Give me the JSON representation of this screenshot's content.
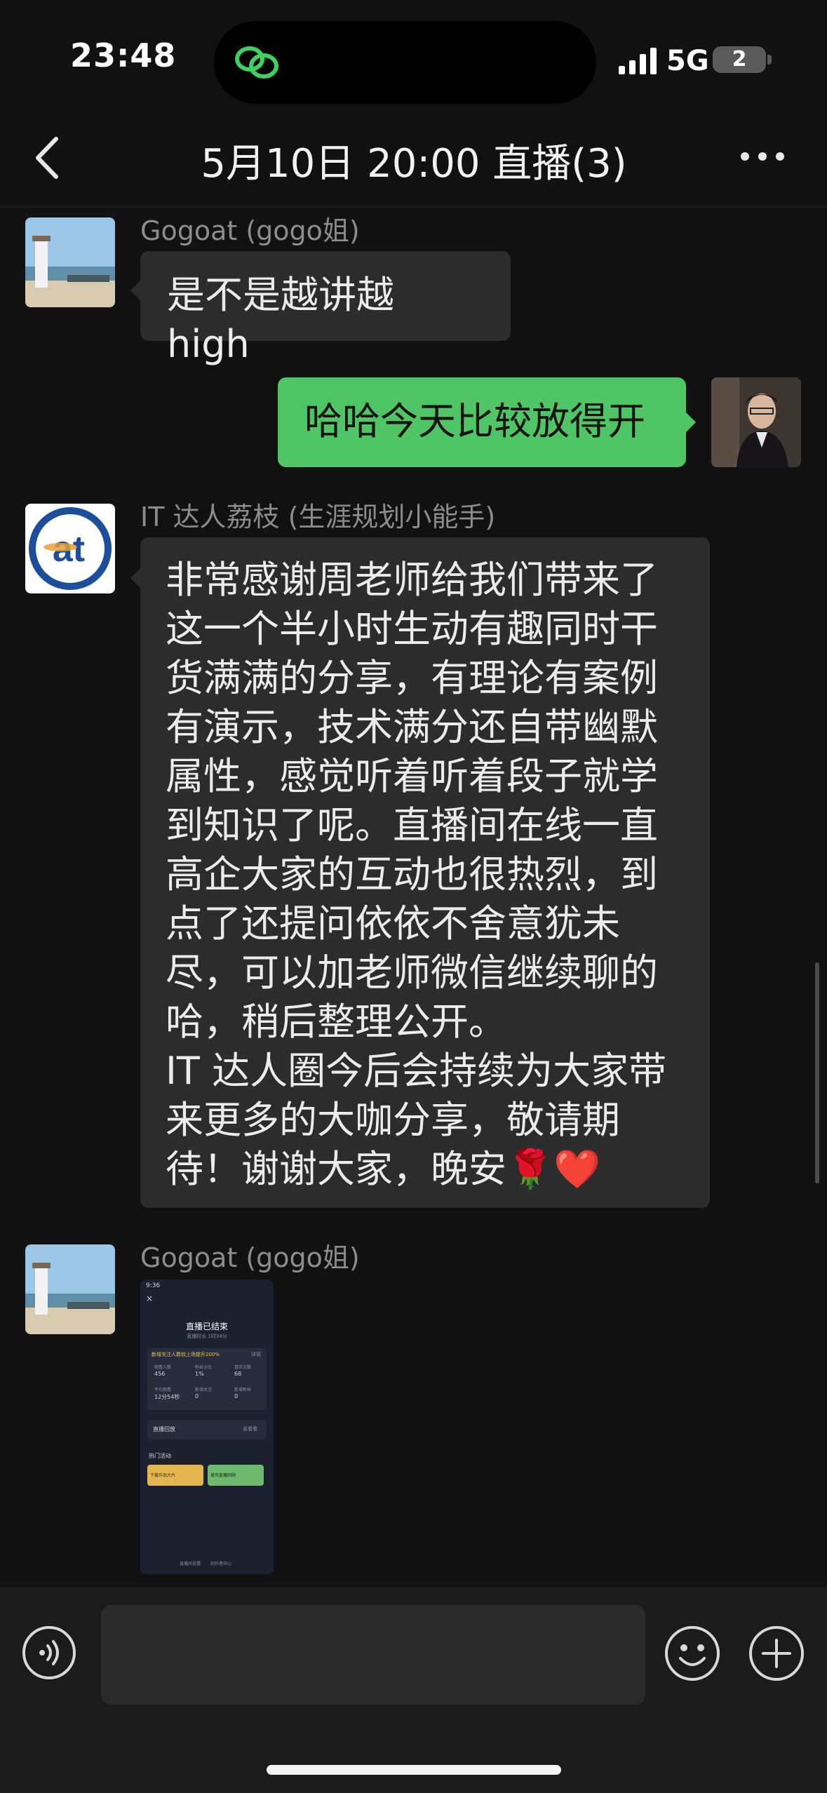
{
  "status": {
    "time": "23:48",
    "network": "5G",
    "battery": "2"
  },
  "nav": {
    "title": "5月10日 20:00 直播(3)"
  },
  "messages": [
    {
      "sender": "Gogoat (gogo姐)",
      "text": "是不是越讲越 high"
    },
    {
      "text": "哈哈今天比较放得开"
    },
    {
      "sender": "IT 达人荔枝 (生涯规划小能手)",
      "lines": [
        "非常感谢周老师给我们带来了",
        "这一个半小时生动有趣同时干",
        "货满满的分享，有理论有案例",
        "有演示，技术满分还自带幽默",
        "属性，感觉听着听着段子就学",
        "到知识了呢。直播间在线一直",
        "高企大家的互动也很热烈，到",
        "点了还提问依依不舍意犹未",
        "尽，可以加老师微信继续聊的",
        "哈，稍后整理公开。",
        "IT 达人圈今后会持续为大家带",
        "来更多的大咖分享，敬请期",
        "待！谢谢大家，晚安"
      ],
      "emojis": "🌹❤️"
    },
    {
      "sender": "Gogoat (gogo姐)",
      "screenshot": {
        "time": "9:36",
        "title": "直播已结束",
        "date": "直播时长 1时34分",
        "banner": "新增关注人数较上场提升200%",
        "banner_action": "详情",
        "stats": [
          [
            "观看人数",
            "456"
          ],
          [
            "粉丝占比",
            "1%"
          ],
          [
            "喜欢次数",
            "68"
          ],
          [
            "平均观看",
            "12分54秒"
          ],
          [
            "新增关注",
            "0"
          ],
          [
            "新增粉丝",
            "0"
          ]
        ],
        "row": "直播回放",
        "row_right": "去看看",
        "section": "热门活动",
        "card1": "下载作品大片",
        "card2": "发布直播回顾",
        "footer1": "直播间设置",
        "footer2": "创作者中心"
      }
    }
  ],
  "colors": {
    "background": "#111111",
    "bubble_in": "#2c2c2c",
    "bubble_out": "#4fc565"
  }
}
